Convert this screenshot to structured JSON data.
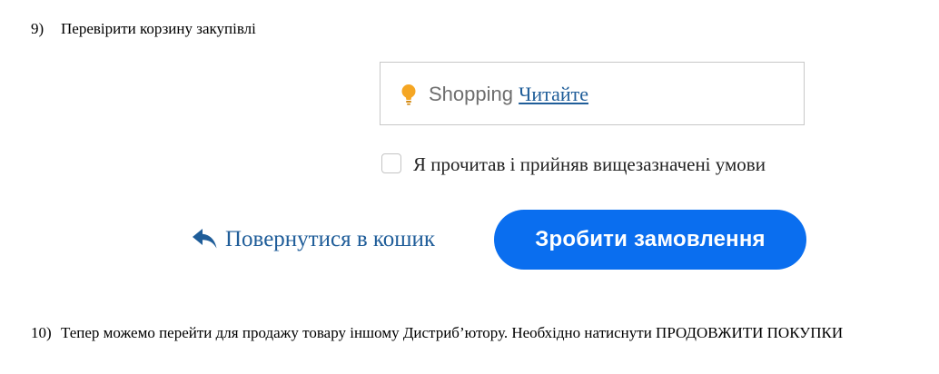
{
  "steps": {
    "step9": {
      "number": "9)",
      "text": "Перевірити корзину закупівлі"
    },
    "step10": {
      "number": "10)",
      "text": "Тепер можемо перейти для продажу товару іншому Дистриб’ютору. Необхідно натиснути ПРОДОВЖИТИ ПОКУПКИ"
    }
  },
  "notice": {
    "icon": "lightbulb-icon",
    "text": "Shopping",
    "link_label": "Читайте",
    "icon_color": "#f5a623"
  },
  "terms": {
    "checked": false,
    "label": "Я прочитав і прийняв вищезазначені умови"
  },
  "back_link": {
    "icon": "reply-arrow-icon",
    "label": "Повернутися в кошик",
    "color": "#1f5d99"
  },
  "order_button": {
    "label": "Зробити замовлення",
    "color": "#0a6eef"
  }
}
